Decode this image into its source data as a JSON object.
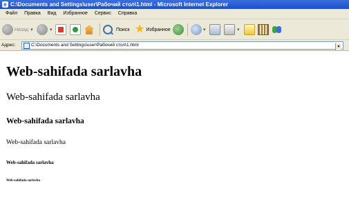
{
  "window": {
    "title": "C:\\Documents and Settings\\user\\Рабочий стол\\1.html - Microsoft Internet Explorer"
  },
  "menu": [
    "Файл",
    "Правка",
    "Вид",
    "Избранное",
    "Сервис",
    "Справка"
  ],
  "toolbar": {
    "back_label": "Назад",
    "search_label": "Поиск",
    "favorites_label": "Избранное"
  },
  "address": {
    "label": "Адрес:",
    "value": "C:\\Documents and Settings\\user\\Рабочий стол\\1.html"
  },
  "content": {
    "headings": [
      "Web-sahifada sarlavha",
      "Web-sahifada sarlavha",
      "Web-sahifada sarlavha",
      "Web-sahifada sarlavha",
      "Web-sahifada sarlavha",
      "Web-sahifada sarlavha"
    ]
  }
}
